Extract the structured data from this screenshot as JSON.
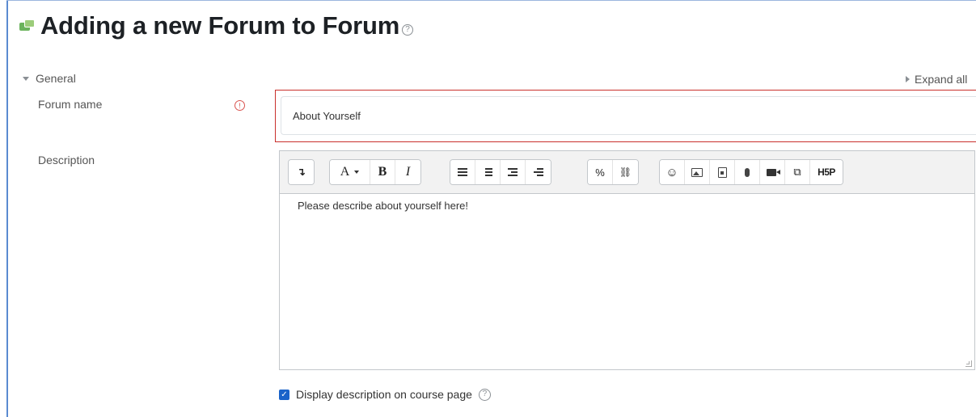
{
  "page": {
    "title": "Adding a new Forum to Forum",
    "help_glyph": "?",
    "expand_all": "Expand all"
  },
  "section": {
    "label": "General"
  },
  "form": {
    "forum_name_label": "Forum name",
    "forum_name_value": "About Yourself",
    "required_glyph": "!",
    "description_label": "Description",
    "description_content": "Please describe about yourself here!",
    "display_description_label": "Display description on course page",
    "display_description_checked": true
  },
  "toolbar": {
    "groups": [
      [
        "collapse-icon"
      ],
      [
        "font-style-dropdown",
        "bold",
        "italic"
      ],
      [
        "unordered-list-icon",
        "ordered-list-icon",
        "outdent-icon",
        "indent-icon"
      ],
      [
        "link-icon",
        "unlink-icon"
      ],
      [
        "emoticon-icon",
        "image-icon",
        "media-icon",
        "record-audio-icon",
        "record-video-icon",
        "manage-files-icon",
        "h5p-icon"
      ]
    ],
    "labels": {
      "collapse": "↴",
      "font": "A",
      "bold": "B",
      "italic": "I",
      "link": "%",
      "unlink": "⛓",
      "emoticon": "☺",
      "files": "⧉",
      "h5p": "H5P"
    }
  },
  "colors": {
    "required": "#c9302c",
    "checkbox": "#1a63c9",
    "frame": "#5b8bd1"
  }
}
